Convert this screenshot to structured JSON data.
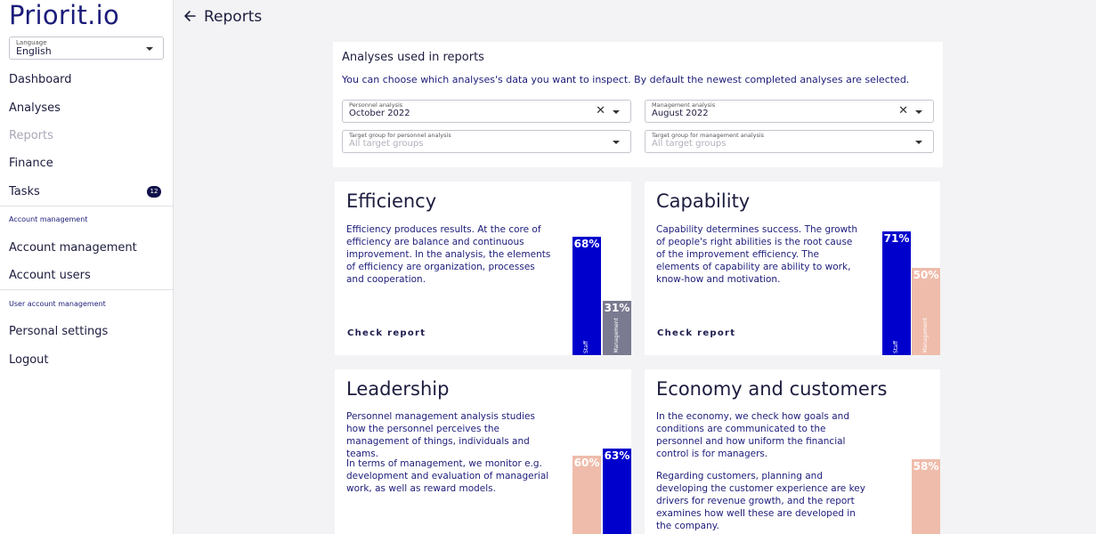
{
  "colors": {
    "staff": "#0000cc",
    "management_gray": "#7a7a90",
    "management_peach": "#efbcab",
    "brand": "#1c1c7a"
  },
  "sidebar": {
    "logo": "Priorit.io",
    "language": {
      "label": "Language",
      "value": "English"
    },
    "items": [
      {
        "label": "Dashboard"
      },
      {
        "label": "Analyses"
      },
      {
        "label": "Reports"
      },
      {
        "label": "Finance"
      },
      {
        "label": "Tasks",
        "badge": "12"
      }
    ],
    "section_account": "Account management",
    "account_items": [
      {
        "label": "Account management"
      },
      {
        "label": "Account users"
      }
    ],
    "section_user": "User account management",
    "user_items": [
      {
        "label": "Personal settings"
      },
      {
        "label": "Logout"
      }
    ]
  },
  "header": {
    "title": "Reports",
    "back_icon": "arrow-left-icon"
  },
  "analyses": {
    "title": "Analyses used in reports",
    "description": "You can choose which analyses's data you want to inspect. By default the newest completed analyses are selected.",
    "personnel": {
      "label": "Personnel analysis",
      "value": "October 2022"
    },
    "management": {
      "label": "Management analysis",
      "value": "August 2022"
    },
    "target_personnel": {
      "label": "Target group for personnel analysis",
      "placeholder": "All target groups"
    },
    "target_management": {
      "label": "Target group for management analysis",
      "placeholder": "All target groups"
    }
  },
  "cards": [
    {
      "title": "Efficiency",
      "text": "Efficiency produces results. At the core of efficiency are balance and continuous improvement. In the analysis, the elements of efficiency are organization, processes and cooperation.",
      "link": "Check report",
      "bars": [
        {
          "label": "Staff",
          "pct": "68%"
        },
        {
          "label": "Management",
          "pct": "31%"
        }
      ]
    },
    {
      "title": "Capability",
      "text": "Capability determines success. The growth of people's right abilities is the root cause of the improvement efficiency. The elements of capability are ability to work, know-how and motivation.",
      "link": "Check report",
      "bars": [
        {
          "label": "Staff",
          "pct": "71%"
        },
        {
          "label": "Management",
          "pct": "50%"
        }
      ]
    },
    {
      "title": "Leadership",
      "text1": "Personnel management analysis studies how the personnel perceives the management of things, individuals and teams.",
      "text2": "In terms of management, we monitor e.g. development and evaluation of managerial work, as well as reward models.",
      "bars": [
        {
          "pct": "60%"
        },
        {
          "pct": "63%"
        }
      ]
    },
    {
      "title": "Economy and customers",
      "text1": "In the economy, we check how goals and conditions are communicated to the personnel and how uniform the financial control is for managers.",
      "text2": "Regarding customers, planning and developing the customer experience are key drivers for revenue growth, and the report examines how well these are developed in the company.",
      "bars": [
        {
          "pct": "58%"
        }
      ]
    }
  ]
}
